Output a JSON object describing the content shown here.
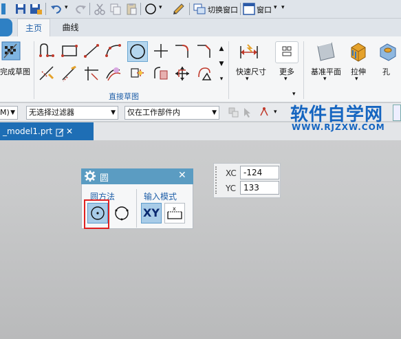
{
  "quick_access": {
    "switch_window": "切换窗口",
    "window_menu": "窗口",
    "undo_dropdown": "▾",
    "window_dropdown": "▾",
    "qat_more": "▾"
  },
  "tabs": [
    {
      "label": "主页",
      "active": true
    },
    {
      "label": "曲线",
      "active": false
    }
  ],
  "ribbon": {
    "finish_sketch_label": "完成草图",
    "group_direct_sketch": "直接草图",
    "quick_dimension": "快速尺寸",
    "more": "更多",
    "datum_plane": "基准平面",
    "extrude": "拉伸",
    "hole": "孔"
  },
  "filter_bar": {
    "left_stub": "M)",
    "selection_filter": "无选择过滤器",
    "scope": "仅在工作部件内"
  },
  "document": {
    "tab_title": "_model1.prt"
  },
  "circle_dialog": {
    "title": "圆",
    "group_method": "圆方法",
    "group_input_mode": "输入模式",
    "xy_label": "XY",
    "close_glyph": "✕"
  },
  "coordinates": {
    "xc_label": "XC",
    "xc_value": "-124",
    "yc_label": "YC",
    "yc_value": "133"
  },
  "watermark": {
    "title": "软件自学网",
    "url": "WWW.RJZXW.COM"
  },
  "colors": {
    "accent": "#1e6eb5",
    "dialog_header": "#5b9cc2",
    "highlight_box": "#e02020",
    "watermark": "#1565c0"
  }
}
